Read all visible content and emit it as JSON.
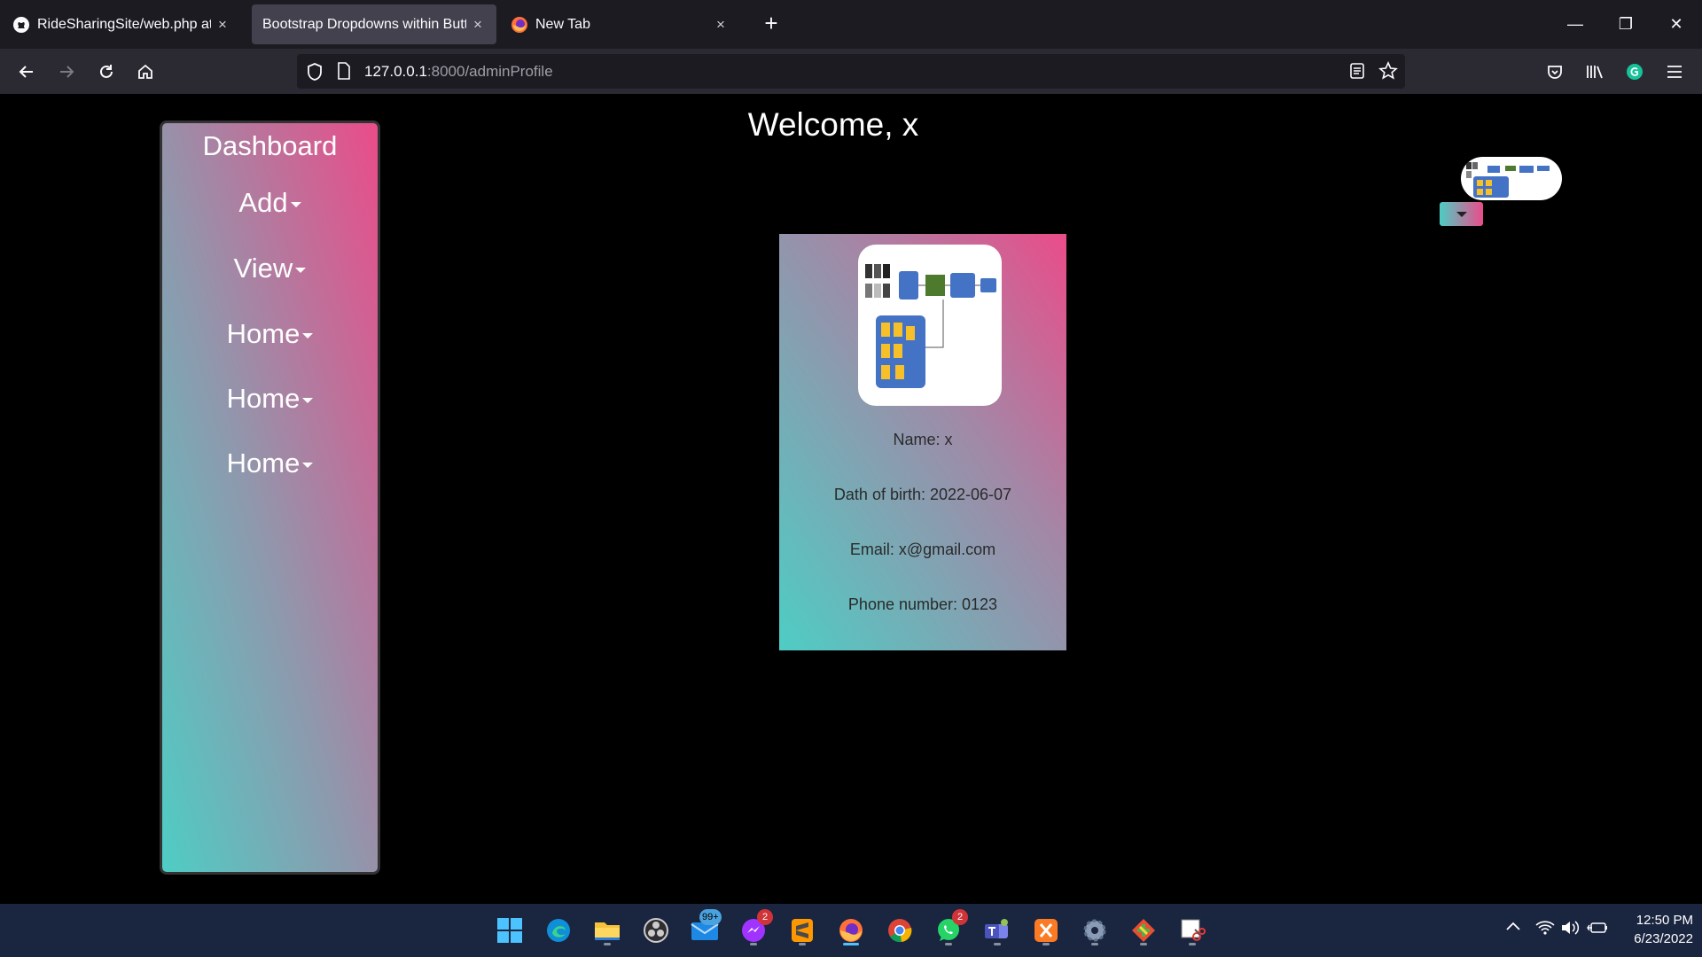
{
  "browser": {
    "tabs": [
      {
        "title": "RideSharingSite/web.php at ma",
        "icon": "github-icon",
        "active": false
      },
      {
        "title": "Bootstrap Dropdowns within Button",
        "icon": "",
        "active": true
      },
      {
        "title": "New Tab",
        "icon": "firefox-icon",
        "active": false
      }
    ],
    "new_tab": "+",
    "window_controls": {
      "minimize": "—",
      "restore": "❐",
      "close": "✕"
    },
    "url": {
      "host": "127.0.0.1",
      "rest": ":8000/adminProfile"
    }
  },
  "page": {
    "welcome": "Welcome, x",
    "sidebar": {
      "title": "Dashboard",
      "items": [
        {
          "label": "Add"
        },
        {
          "label": "View"
        },
        {
          "label": "Home"
        },
        {
          "label": "Home"
        },
        {
          "label": "Home"
        }
      ]
    },
    "profile": {
      "name_line": "Name: x",
      "dob_line": "Dath of birth: 2022-06-07",
      "email_line": "Email: x@gmail.com",
      "phone_line": "Phone number: 0123"
    },
    "accent_colors": {
      "pink": "#ea4c89",
      "teal": "#4ecdc4"
    }
  },
  "taskbar": {
    "apps": [
      {
        "name": "start"
      },
      {
        "name": "edge"
      },
      {
        "name": "file-explorer"
      },
      {
        "name": "obs"
      },
      {
        "name": "mail",
        "badge": "99+"
      },
      {
        "name": "messenger",
        "badge": "2"
      },
      {
        "name": "sublime-text"
      },
      {
        "name": "firefox"
      },
      {
        "name": "chrome"
      },
      {
        "name": "whatsapp",
        "badge": "2"
      },
      {
        "name": "teams"
      },
      {
        "name": "xampp"
      },
      {
        "name": "settings"
      },
      {
        "name": "git-gui"
      },
      {
        "name": "snipping-tool"
      }
    ],
    "time": "12:50 PM",
    "date": "6/23/2022"
  }
}
